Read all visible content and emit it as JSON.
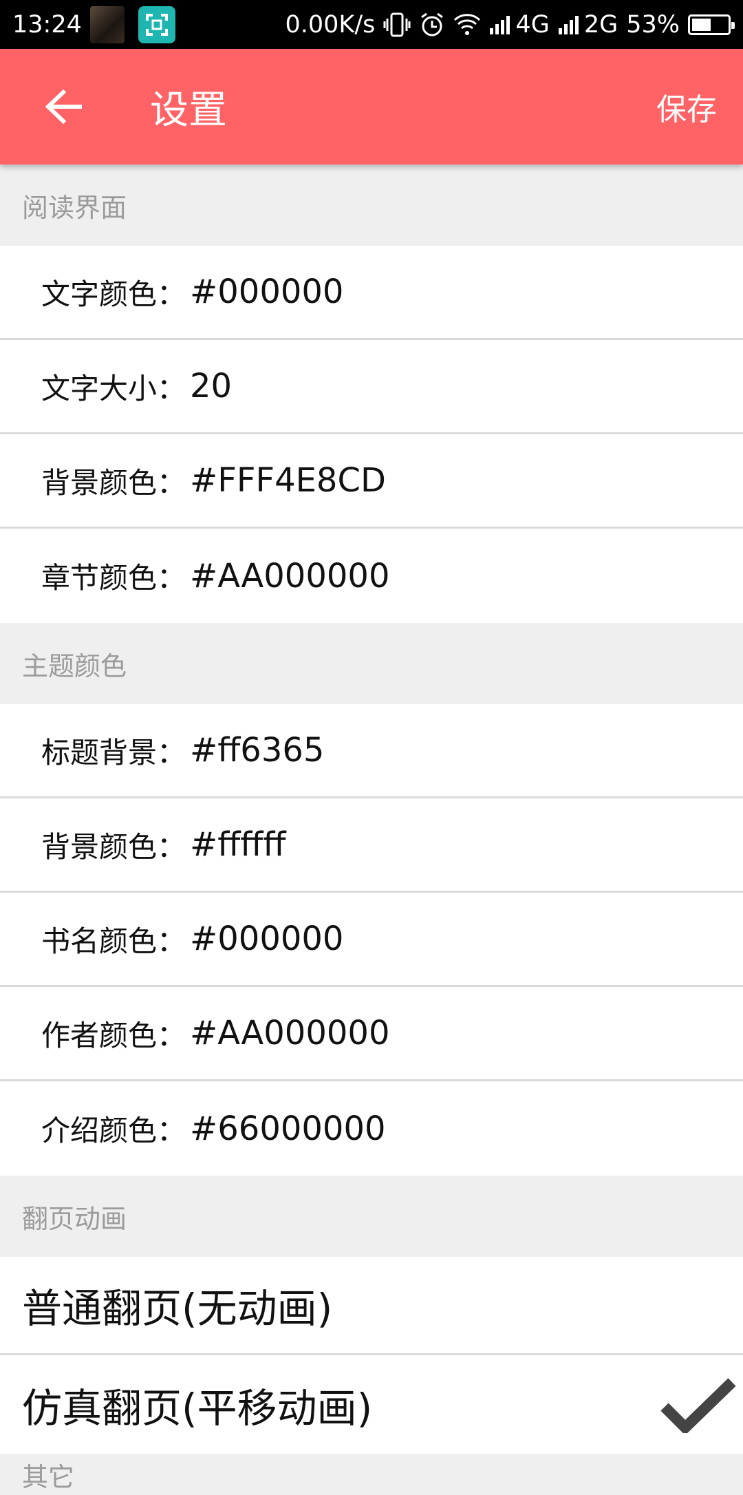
{
  "status_bar": {
    "time": "13:24",
    "net_speed": "0.00K/s",
    "sim1": "4G",
    "sim2": "2G",
    "battery_text": "53%",
    "battery_level": 0.53
  },
  "app_bar": {
    "title": "设置",
    "save_label": "保存",
    "background": "#ff6365"
  },
  "sections": {
    "reading": {
      "header": "阅读界面",
      "rows": [
        {
          "label": "文字颜色：",
          "value": "#000000"
        },
        {
          "label": "文字大小：",
          "value": "20"
        },
        {
          "label": "背景颜色：",
          "value": "#FFF4E8CD"
        },
        {
          "label": "章节颜色：",
          "value": "#AA000000"
        }
      ]
    },
    "theme": {
      "header": "主题颜色",
      "rows": [
        {
          "label": "标题背景：",
          "value": "#ff6365"
        },
        {
          "label": "背景颜色：",
          "value": "#ffffff"
        },
        {
          "label": "书名颜色：",
          "value": "#000000"
        },
        {
          "label": "作者颜色：",
          "value": "#AA000000"
        },
        {
          "label": "介绍颜色：",
          "value": "#66000000"
        }
      ]
    },
    "page_turn": {
      "header": "翻页动画",
      "options": [
        {
          "label": "普通翻页(无动画)",
          "selected": false
        },
        {
          "label": "仿真翻页(平移动画)",
          "selected": true
        }
      ]
    },
    "next": {
      "header": "其它"
    }
  }
}
